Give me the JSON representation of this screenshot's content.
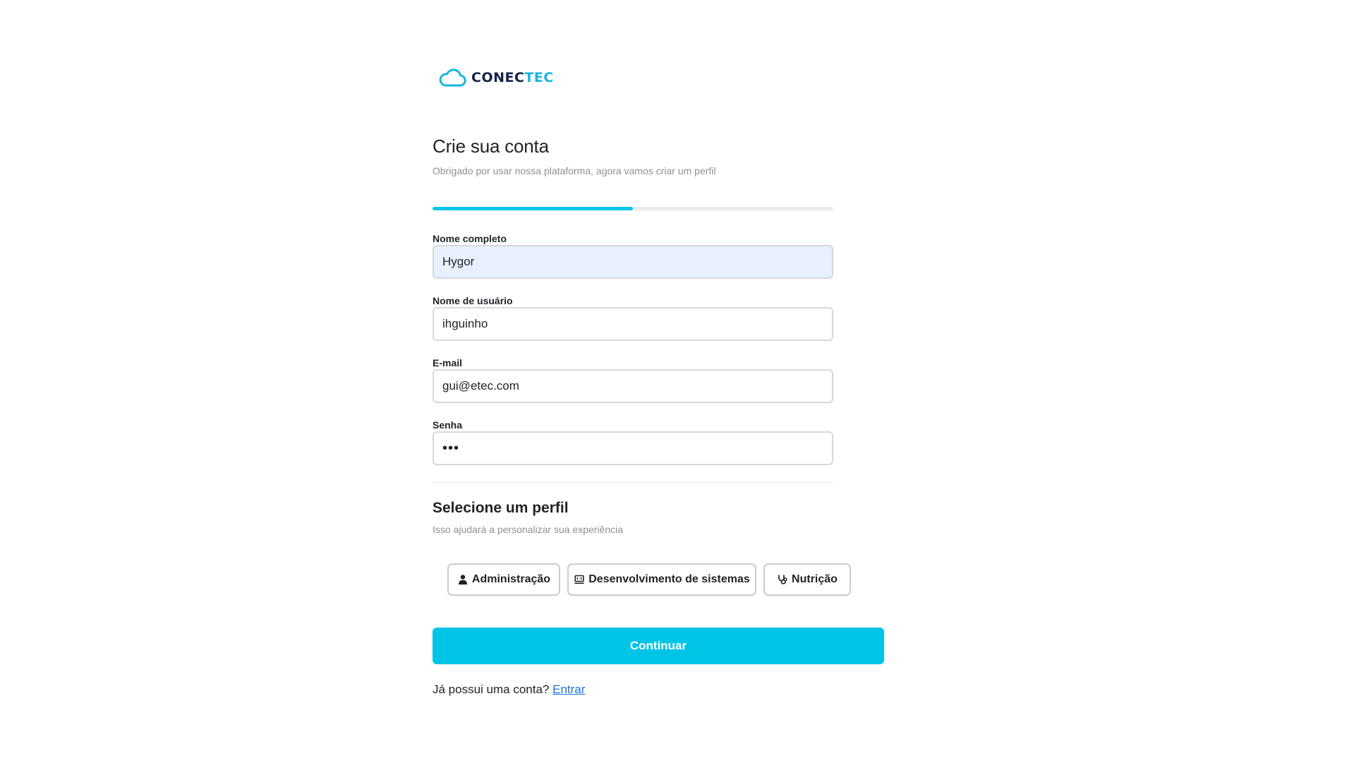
{
  "logo": {
    "icon": "cloud-icon",
    "text_dark": "CONEC",
    "text_accent": "TEC",
    "colors": {
      "dark": "#14224a",
      "accent": "#17b6e0"
    }
  },
  "header": {
    "title": "Crie sua conta",
    "subtitle": "Obrigado por usar nossa plataforma, agora vamos criar um perfil"
  },
  "progress": {
    "value": 0.5,
    "color": "#0bc4e7"
  },
  "form": {
    "full_name": {
      "label": "Nome completo",
      "value": "Hygor"
    },
    "username": {
      "label": "Nome de usuário",
      "value": "ihguinho"
    },
    "email": {
      "label": "E-mail",
      "value": "gui@etec.com"
    },
    "password": {
      "label": "Senha",
      "value": "•••"
    }
  },
  "profile_section": {
    "title": "Selecione um perfil",
    "subtitle": "Isso ajudará a personalizar sua experiência",
    "options": [
      {
        "label": "Administração",
        "icon": "person-icon"
      },
      {
        "label": "Desenvolvimento de sistemas",
        "icon": "laptop-code-icon"
      },
      {
        "label": "Nutrição",
        "icon": "stethoscope-icon"
      }
    ]
  },
  "actions": {
    "continue_label": "Continuar",
    "continue_color": "#00c4e6"
  },
  "footer": {
    "prompt": "Já possui uma conta?",
    "login_link": "Entrar"
  }
}
